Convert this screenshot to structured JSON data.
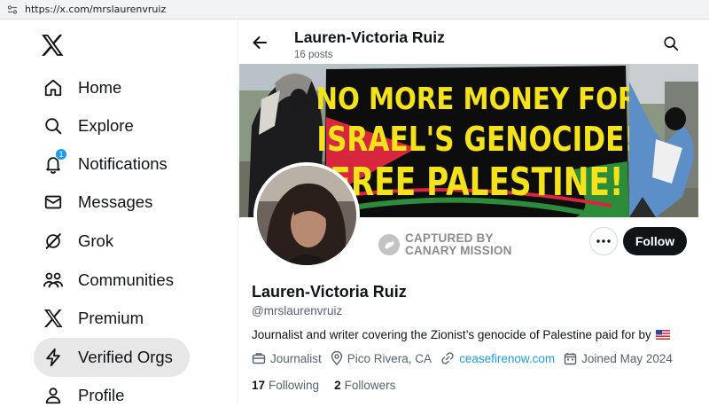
{
  "browser": {
    "url": "https://x.com/mrslaurenvruiz"
  },
  "sidebar": {
    "items": [
      {
        "label": "Home",
        "icon": "home-icon"
      },
      {
        "label": "Explore",
        "icon": "search-icon"
      },
      {
        "label": "Notifications",
        "icon": "bell-icon",
        "badge": "1"
      },
      {
        "label": "Messages",
        "icon": "envelope-icon"
      },
      {
        "label": "Grok",
        "icon": "grok-icon"
      },
      {
        "label": "Communities",
        "icon": "people-icon"
      },
      {
        "label": "Premium",
        "icon": "x-logo-icon"
      },
      {
        "label": "Verified Orgs",
        "icon": "lightning-icon"
      },
      {
        "label": "Profile",
        "icon": "person-icon"
      }
    ]
  },
  "header": {
    "title": "Lauren-Victoria Ruiz",
    "posts": "16 posts"
  },
  "banner": {
    "line1": "NO MORE MONEY FOR",
    "line2": "ISRAEL'S GENOCIDE!",
    "line3": "FREE PALESTINE!"
  },
  "canary": {
    "line1": "CAPTURED BY",
    "line2": "CANARY MISSION"
  },
  "actions": {
    "follow": "Follow"
  },
  "profile": {
    "name": "Lauren-Victoria Ruiz",
    "handle": "@mrslaurenvruiz",
    "bio": "Journalist and writer covering the Zionist’s genocide of Palestine paid for by",
    "category": "Journalist",
    "location": "Pico Rivera, CA",
    "website": "ceasefirenow.com",
    "joined": "Joined May 2024",
    "following_count": "17",
    "following_label": "Following",
    "followers_count": "2",
    "followers_label": "Followers"
  },
  "colors": {
    "accent": "#1d9bf0",
    "text": "#0f1419",
    "muted": "#536471",
    "banner_yellow": "#f4e21a"
  }
}
